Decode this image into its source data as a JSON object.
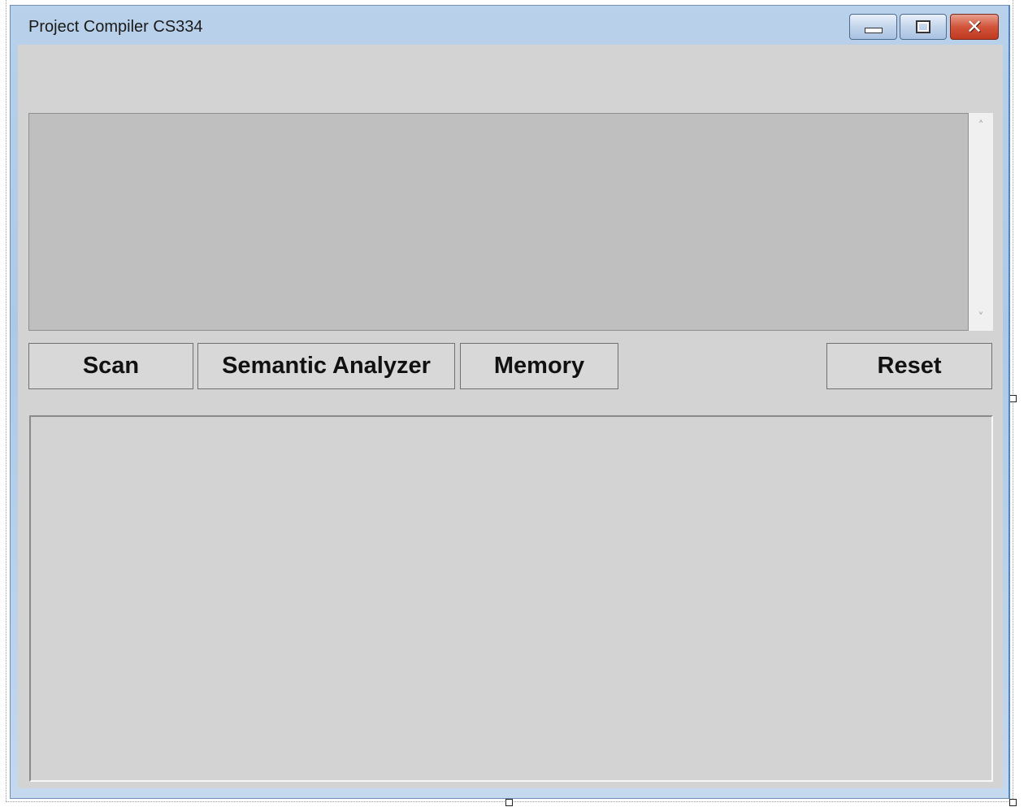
{
  "window": {
    "title": "Project Compiler CS334",
    "controls": {
      "minimize_icon": "minimize-icon",
      "maximize_icon": "maximize-icon",
      "close_icon": "close-icon",
      "close_glyph": "✕"
    }
  },
  "input_area": {
    "value": "",
    "scroll_up_glyph": "˄",
    "scroll_down_glyph": "˅"
  },
  "toolbar": {
    "scan_label": "Scan",
    "semantic_label": "Semantic Analyzer",
    "memory_label": "Memory",
    "reset_label": "Reset"
  },
  "output_panel": {
    "content": ""
  },
  "colors": {
    "client_background": "#d3d3d3",
    "input_background": "#bfbfbf",
    "button_face": "#d8d8d8",
    "close_button": "#c0391f",
    "titlebar": "#b9d1ea"
  }
}
